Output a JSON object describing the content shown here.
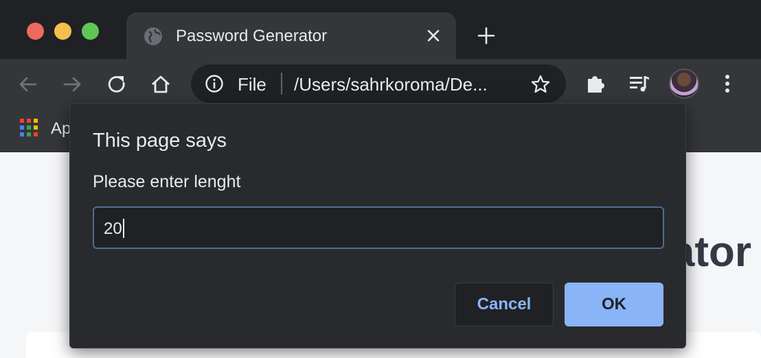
{
  "browser": {
    "tab": {
      "title": "Password Generator"
    },
    "omnibox": {
      "scheme_label": "File",
      "url": "/Users/sahrkoroma/De..."
    },
    "bookmarks": {
      "apps_label": "Apps"
    }
  },
  "page": {
    "heading_fragment": "ator"
  },
  "dialog": {
    "title": "This page says",
    "message": "Please enter lenght",
    "input_value": "20",
    "cancel_label": "Cancel",
    "ok_label": "OK"
  },
  "colors": {
    "accent": "#8ab4f8",
    "dialog_bg": "#292a2d",
    "toolbar_bg": "#35363a",
    "input_border": "#4c6f93"
  },
  "icons": [
    "globe-icon",
    "close-icon",
    "plus-icon",
    "back-icon",
    "forward-icon",
    "reload-icon",
    "home-icon",
    "info-icon",
    "star-icon",
    "extensions-icon",
    "media-icon",
    "menu-icon",
    "apps-icon"
  ]
}
